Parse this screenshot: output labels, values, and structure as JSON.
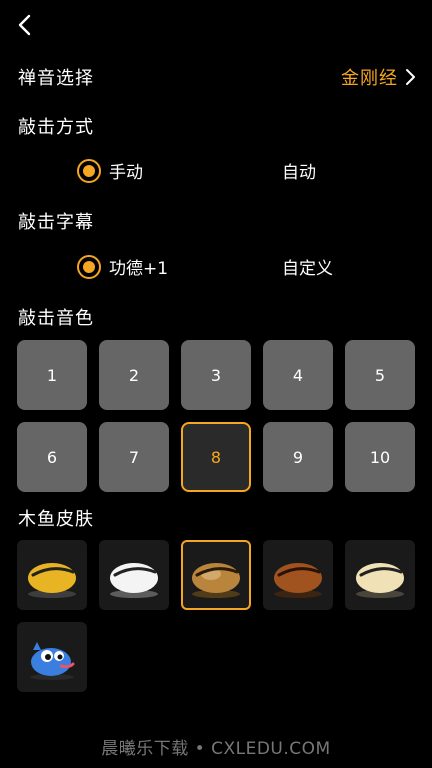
{
  "header": {
    "back_icon": "chevron-left-icon"
  },
  "zen": {
    "label": "禅音选择",
    "value": "金刚经",
    "chevron_icon": "chevron-right-icon"
  },
  "strike_method": {
    "title": "敲击方式",
    "options": [
      "手动",
      "自动"
    ],
    "selected": 0
  },
  "strike_caption": {
    "title": "敲击字幕",
    "options": [
      "功德+1",
      "自定义"
    ],
    "selected": 0
  },
  "tone": {
    "title": "敲击音色",
    "options": [
      "1",
      "2",
      "3",
      "4",
      "5",
      "6",
      "7",
      "8",
      "9",
      "10"
    ],
    "selected": 7
  },
  "skin": {
    "title": "木鱼皮肤",
    "items": [
      "gold-wooden-fish-icon",
      "white-wooden-fish-icon",
      "bronze-wooden-fish-icon",
      "brown-wooden-fish-icon",
      "cream-wooden-fish-icon",
      "blue-cartoon-fish-icon"
    ],
    "selected": 2
  },
  "watermark": "晨曦乐下载 • CXLEDU.COM",
  "colors": {
    "accent": "#f5a623",
    "tile": "#666666",
    "background": "#000000"
  }
}
